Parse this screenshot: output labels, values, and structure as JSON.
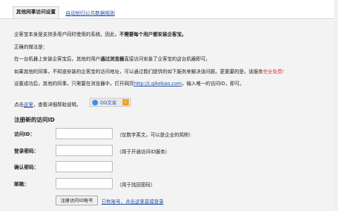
{
  "tabs": {
    "active": "其他同事访问设置",
    "link": "自动划归公共数据规则"
  },
  "intro": {
    "l1a": "企客宝本身是支持多用户同时使用的系统。因此，",
    "l1b": "不需要每个用户都安装企客宝。",
    "l2": "正确的做法是：",
    "l3a": "在一台机器上安装企客宝后，其他的用户",
    "l3b": "通过浏览器",
    "l3c": "直接访问安装了企客宝的这台机器即可。",
    "l4a": "如果其他的同事，不知道安装的企客宝的访问地址，可以通过我们提供的如下服务来解决该问题。更重要的是，该服务",
    "l4b": "完全免费!",
    "l5a": "设置成功后，其他的同事，只需要在浏览器中，打开网页",
    "l5b": "http://i.qikebao.com",
    "l5c": "，输入唯一的访问ID，即可。",
    "l6a": "点击",
    "l6b": "这里",
    "l6c": "，查看详细帮助说明。"
  },
  "qq": {
    "label": "QQ交谈",
    "icon": "qq-penguin-icon"
  },
  "form": {
    "title": "注册新的访问ID",
    "fields": [
      {
        "label": "访问ID：",
        "value": "",
        "hint": "（仅数字英文，可以是企业的简称）"
      },
      {
        "label": "登录密码：",
        "value": "",
        "hint": "（用于开通访问ID服务）"
      },
      {
        "label": "确认密码：",
        "value": "",
        "hint": ""
      },
      {
        "label": "邮箱：",
        "value": "",
        "hint": "（用于找回密码）"
      }
    ],
    "submit": "注册访问ID账号",
    "login_link": "已有账号，点击这里直接登录"
  }
}
